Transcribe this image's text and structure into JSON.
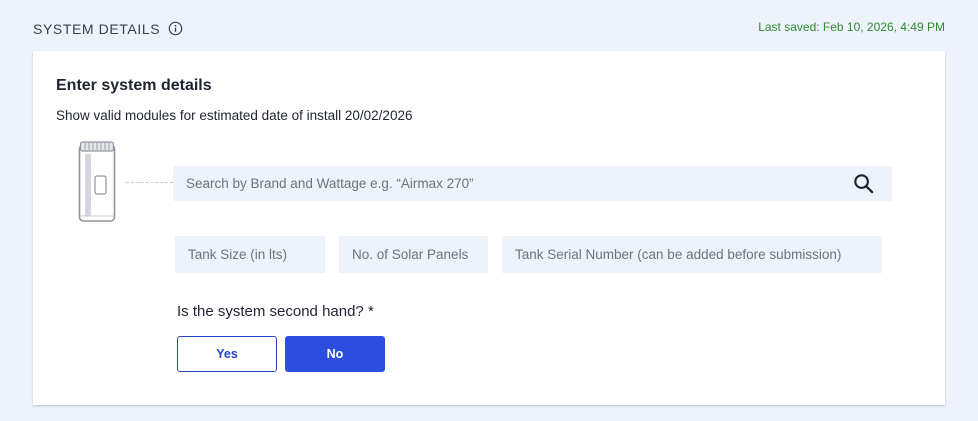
{
  "header": {
    "section_title": "SYSTEM DETAILS",
    "last_saved": "Last saved: Feb 10, 2026, 4:49 PM"
  },
  "card": {
    "title": "Enter system details",
    "subtitle": "Show valid modules for estimated date of install 20/02/2026",
    "product_icon": "water-tank-icon"
  },
  "search": {
    "placeholder": "Search by Brand and Wattage e.g. “Airmax 270”",
    "value": "",
    "icon": "search-icon"
  },
  "fields": {
    "tank_size_placeholder": "Tank Size (in lts)",
    "solar_panels_placeholder": "No. of Solar Panels",
    "serial_placeholder": "Tank Serial Number (can be added before submission)"
  },
  "second_hand": {
    "question": "Is the system second hand? *",
    "yes_label": "Yes",
    "no_label": "No",
    "selected": "No"
  },
  "colors": {
    "accent": "#2b4de0",
    "saved_text": "#2e8b2e",
    "page_background": "#eef2fb"
  }
}
